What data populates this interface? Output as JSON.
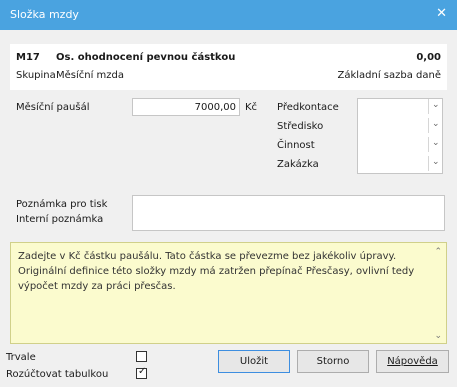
{
  "window": {
    "title": "Složka mzdy",
    "close_glyph": "✕"
  },
  "header": {
    "code": "M17",
    "name": "Os. ohodnocení pevnou částkou",
    "amount": "0,00",
    "group_label": "Skupina",
    "group_value": "Měsíční mzda",
    "tax_base": "Základní sazba daně"
  },
  "form": {
    "monthly_flat_label": "Měsíční paušál",
    "monthly_flat_value": "7000,00",
    "currency": "Kč",
    "pre_contact_label": "Předkontace",
    "center_label": "Středisko",
    "activity_label": "Činnost",
    "order_label": "Zakázka",
    "print_note_label": "Poznámka pro tisk",
    "internal_note_label": "Interní poznámka"
  },
  "help_text": "Zadejte v Kč částku paušálu. Tato částka se převezme bez jakékoliv úpravy. Originální definice této složky mzdy má zatržen přepínač Přesčasy, ovlivní tedy výpočet mzdy za práci přesčas.",
  "options": {
    "permanent_label": "Trvale",
    "permanent_checked": false,
    "split_label": "Rozúčtovat tabulkou",
    "split_checked": true
  },
  "buttons": {
    "save": "Uložit",
    "cancel": "Storno",
    "help": "Nápověda"
  },
  "icons": {
    "dropdown": "chevron-down-icon",
    "checkmark": "check-icon"
  },
  "colors": {
    "titlebar": "#4aa3e0",
    "note_bg": "#fbfbce"
  }
}
